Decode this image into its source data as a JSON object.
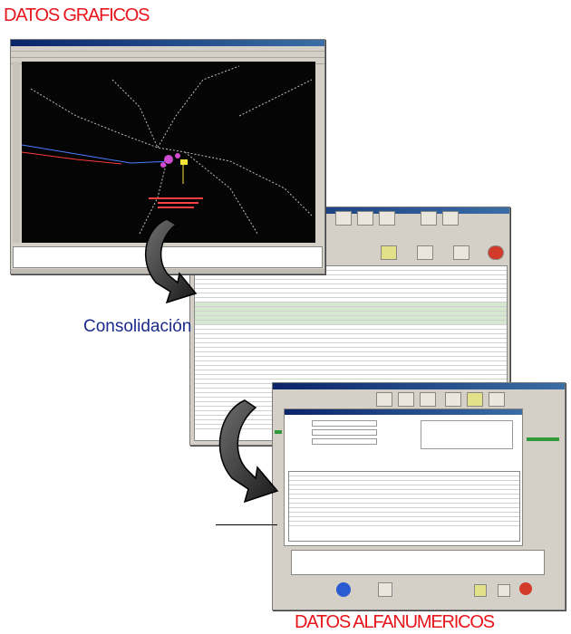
{
  "title_top": "DATOS GRAFICOS",
  "title_bottom": "DATOS ALFANUMERICOS",
  "middle_label": "Consolidación",
  "colors": {
    "title": "#e8141b",
    "label": "#1a2a8c",
    "window_chrome": "#d4d0c8",
    "cad_background": "#050505"
  },
  "icons": [
    "curved-arrow-icon",
    "curved-arrow-icon"
  ]
}
